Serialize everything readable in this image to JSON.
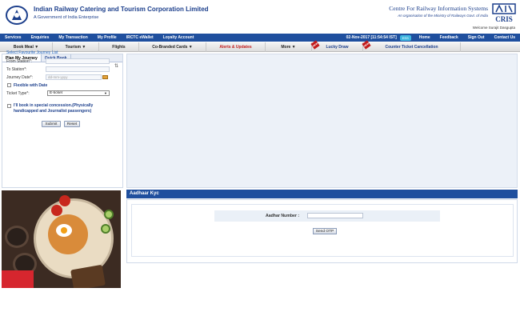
{
  "header": {
    "org_name": "Indian Railway Catering and Tourism Corporation Limited",
    "org_sub": "A Government of India Enterprise",
    "cris_name": "Centre For Railway Information Systems",
    "cris_sub": "An organisation of the Ministry of Railways Govt. of India",
    "cris_logo_text": "CRIS",
    "welcome": "Welcome Surajit Dasgupta"
  },
  "nav1": {
    "items": [
      "Services",
      "Enquiries",
      "My Transaction",
      "My Profile",
      "IRCTC eWallet",
      "Loyalty Account"
    ],
    "datetime": "02-Nov-2017 [11:54:54 IST]",
    "badge": "ESS",
    "right_items": [
      "Home",
      "Feedback",
      "Sign Out",
      "Contact Us"
    ]
  },
  "nav2": {
    "items": [
      {
        "label": "Book Meal ▼",
        "style": "normal"
      },
      {
        "label": "Tourism ▼",
        "style": "normal"
      },
      {
        "label": "Flights",
        "style": "normal"
      },
      {
        "label": "Co-Branded Cards ▼",
        "style": "normal"
      },
      {
        "label": "Alerts & Updates",
        "style": "red"
      },
      {
        "label": "More ▼",
        "style": "normal"
      },
      {
        "label": "Lucky Draw",
        "style": "blue",
        "new": true
      },
      {
        "label": "Counter Ticket Cancellation",
        "style": "blue",
        "new": true
      }
    ],
    "new_tag": "NEW"
  },
  "journey": {
    "tabs": [
      "Plan My Journey",
      "Quick Book"
    ],
    "fav_link": "Select Favourite Journey List",
    "from_label": "From Station*:",
    "to_label": "To Station*:",
    "date_label": "Journey Date*:",
    "date_placeholder": "dd-mm-yyyy",
    "flexible_label": "Flexible with Date",
    "ticket_type_label": "Ticket Type*:",
    "ticket_type_value": "E-ticket",
    "concession_label": "I'll book in special concession.(Physically handicapped and Journalist passengers)",
    "submit": "Submit",
    "reset": "Reset"
  },
  "kyc": {
    "title": "Aadhaar Kyc",
    "label": "Aadhar Number :",
    "button": "Send OTP"
  }
}
